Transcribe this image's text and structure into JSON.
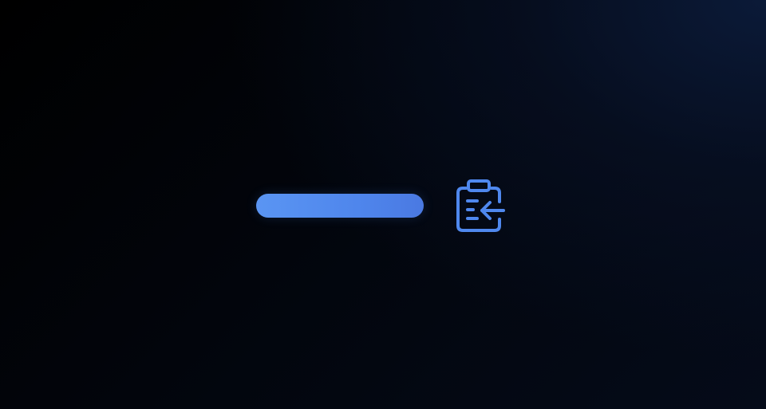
{
  "paste_control": {
    "pill_label": "",
    "icon": "clipboard-paste-icon",
    "accent_color": "#4f88ee"
  }
}
